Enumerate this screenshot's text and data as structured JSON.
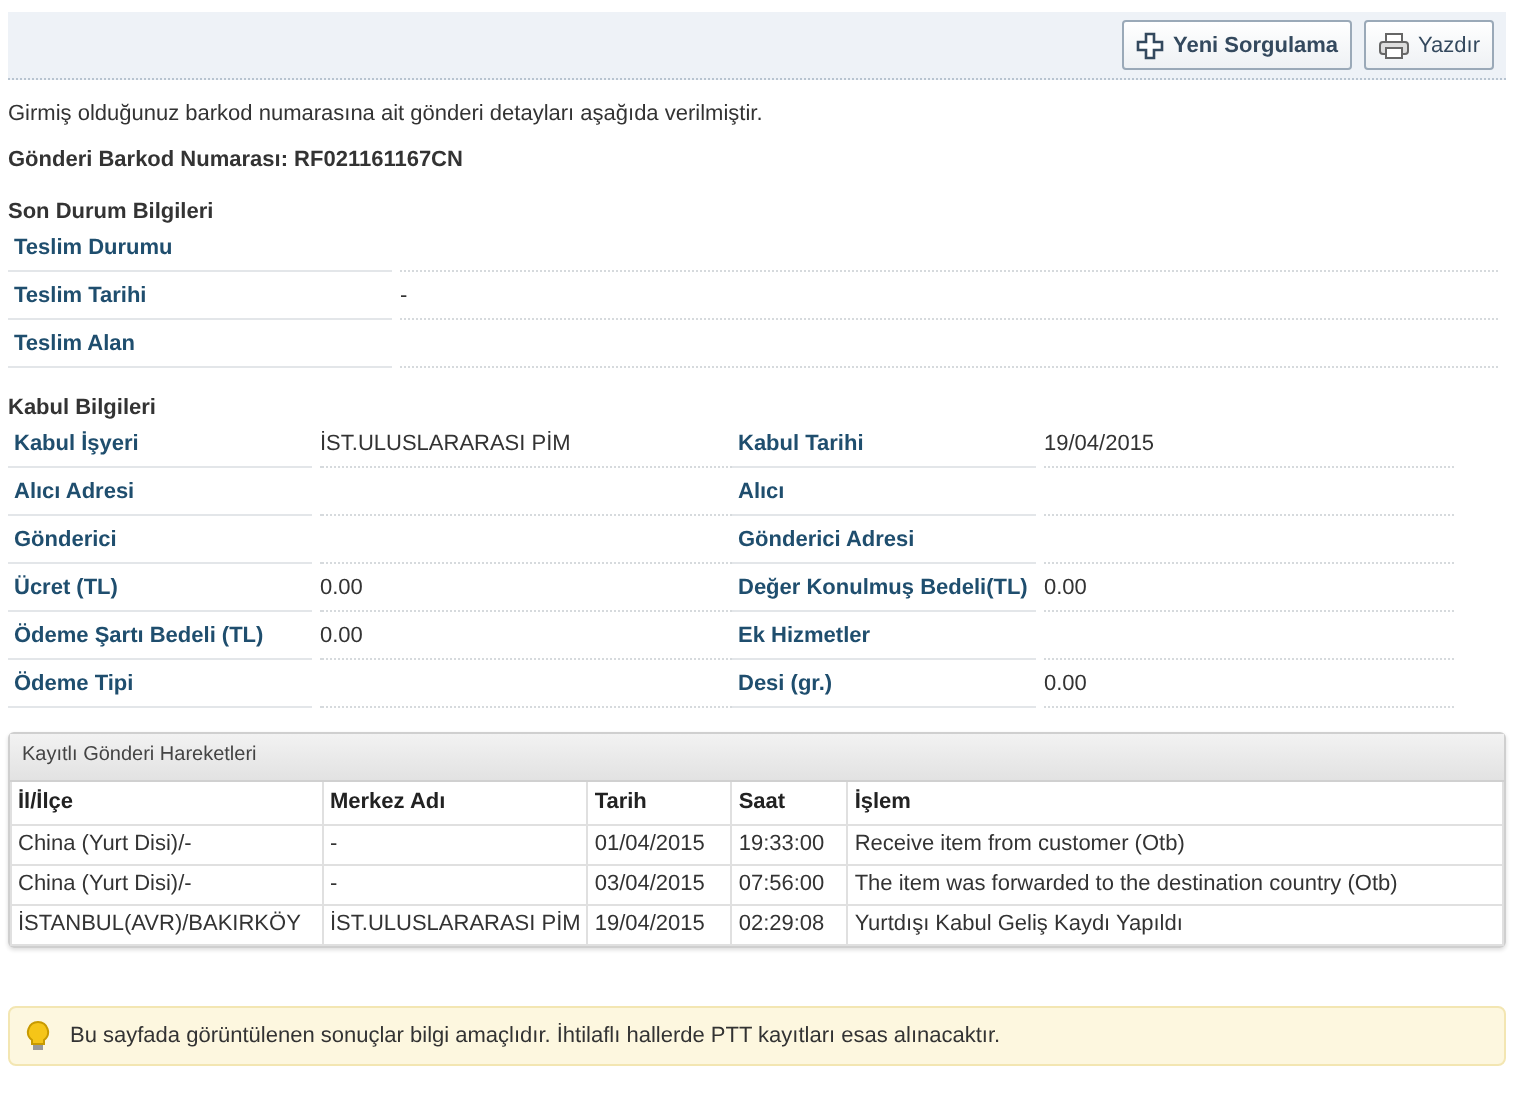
{
  "toolbar": {
    "buttons": [
      {
        "kind": "new",
        "label": "Yeni Sorgulama"
      },
      {
        "kind": "print",
        "label": "Yazdır"
      }
    ]
  },
  "intro": "Girmiş olduğunuz barkod numarasına ait gönderi detayları aşağıda verilmiştir.",
  "barcode": {
    "label": "Gönderi Barkod Numarası:",
    "value": "RF021161167CN"
  },
  "status_section": {
    "title": "Son Durum Bilgileri",
    "rows": [
      {
        "label": "Teslim Durumu"
      },
      {
        "label": "Teslim Tarihi",
        "value": "-"
      },
      {
        "label": "Teslim Alan"
      }
    ]
  },
  "acceptance_section": {
    "title": "Kabul Bilgileri",
    "rows": [
      [
        {
          "label": "Kabul İşyeri",
          "value": "İST.ULUSLARARASI PİM"
        },
        {
          "label": "Kabul Tarihi",
          "value": "19/04/2015"
        }
      ],
      [
        {
          "label": "Alıcı Adresi"
        },
        {
          "label": "Alıcı"
        }
      ],
      [
        {
          "label": "Gönderici"
        },
        {
          "label": "Gönderici Adresi"
        }
      ],
      [
        {
          "label": "Ücret (TL)",
          "value": "0.00"
        },
        {
          "label": "Değer Konulmuş Bedeli(TL)",
          "value": "0.00"
        }
      ],
      [
        {
          "label": "Ödeme Şartı Bedeli (TL)",
          "value": "0.00"
        },
        {
          "label": "Ek Hizmetler"
        }
      ],
      [
        {
          "label": "Ödeme Tipi"
        },
        {
          "label": "Desi (gr.)",
          "value": "0.00"
        }
      ]
    ]
  },
  "movements": {
    "title": "Kayıtlı Gönderi Hareketleri",
    "columns": [
      "İl/İlçe",
      "Merkez Adı",
      "Tarih",
      "Saat",
      "İşlem"
    ],
    "rows": [
      [
        "China (Yurt Disi)/-",
        "-",
        "01/04/2015",
        "19:33:00",
        "Receive item from customer (Otb)"
      ],
      [
        "China (Yurt Disi)/-",
        "-",
        "03/04/2015",
        "07:56:00",
        "The item was forwarded to the destination country (Otb)"
      ],
      [
        "İSTANBUL(AVR)/BAKIRKÖY",
        "İST.ULUSLARARASI PİM",
        "19/04/2015",
        "02:29:08",
        "Yurtdışı Kabul Geliş Kaydı Yapıldı"
      ]
    ]
  },
  "notice": "Bu sayfada görüntülenen sonuçlar bilgi amaçlıdır. İhtilaflı hallerde PTT kayıtları esas alınacaktır."
}
